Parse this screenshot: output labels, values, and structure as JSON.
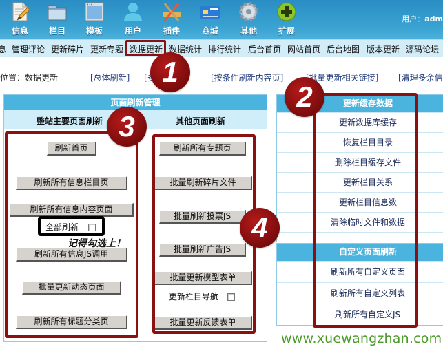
{
  "toolbar": {
    "items": [
      {
        "label": "信息",
        "icon": "document-pencil-icon"
      },
      {
        "label": "栏目",
        "icon": "folder-icon"
      },
      {
        "label": "模板",
        "icon": "window-template-icon"
      },
      {
        "label": "用户",
        "icon": "user-icon"
      },
      {
        "label": "插件",
        "icon": "plugin-tools-icon"
      },
      {
        "label": "商城",
        "icon": "credit-card-icon"
      },
      {
        "label": "其他",
        "icon": "gear-icon"
      },
      {
        "label": "扩展",
        "icon": "plus-circle-icon"
      }
    ],
    "user_label": "用户：",
    "user_name": "adm"
  },
  "navbar": {
    "items": [
      "息",
      "管理评论",
      "更新碎片",
      "更新专题",
      "数据更新",
      "数据统计",
      "排行统计",
      "后台首页",
      "网站首页",
      "后台地图",
      "版本更新",
      "源码论坛"
    ],
    "active": "数据更新"
  },
  "location": {
    "label": "位置：数据更新",
    "links": [
      "[总体刷新]",
      "[多",
      "[按条件刷新内容页]",
      "[批量更新相关链接]",
      "[清理多余信"
    ]
  },
  "left_panel": {
    "title": "页面刷新管理",
    "main_heading": "整站主要页面刷新",
    "other_heading": "其他页面刷新",
    "main_buttons": [
      "刷新首页",
      "刷新所有信息栏目页",
      "刷新所有信息内容页面",
      "刷新所有信息JS调用",
      "批量更新动态页面",
      "刷新所有标题分类页"
    ],
    "full_refresh_label": "全部刷新",
    "full_refresh_checked": false,
    "reminder_note": "记得勾选上！",
    "other_buttons": [
      "刷新所有专题页",
      "批量刷新碎片文件",
      "批量刷新投票JS",
      "批量刷新广告JS",
      "批量更新模型表单",
      "批量更新反馈表单"
    ],
    "update_nav_label": "更新栏目导航",
    "update_nav_checked": false
  },
  "cache_panel": {
    "title": "更新缓存数据",
    "items": [
      "更新数据库缓存",
      "恢复栏目目录",
      "删除栏目缓存文件",
      "更新栏目关系",
      "更新栏目信息数",
      "清除临时文件和数据"
    ]
  },
  "custom_panel": {
    "title": "自定义页面刷新",
    "items": [
      "刷新所有自定义页面",
      "刷新所有自定义列表",
      "刷新所有自定义JS"
    ]
  },
  "badges": [
    "1",
    "2",
    "3",
    "4"
  ],
  "watermark": "www.xuewangzhan.com",
  "colors": {
    "toolbar_blue": "#3aa3d2",
    "panel_head_blue": "#4ab3de",
    "annotation_red": "#8b1111",
    "watermark_green": "#4a9a2a"
  }
}
